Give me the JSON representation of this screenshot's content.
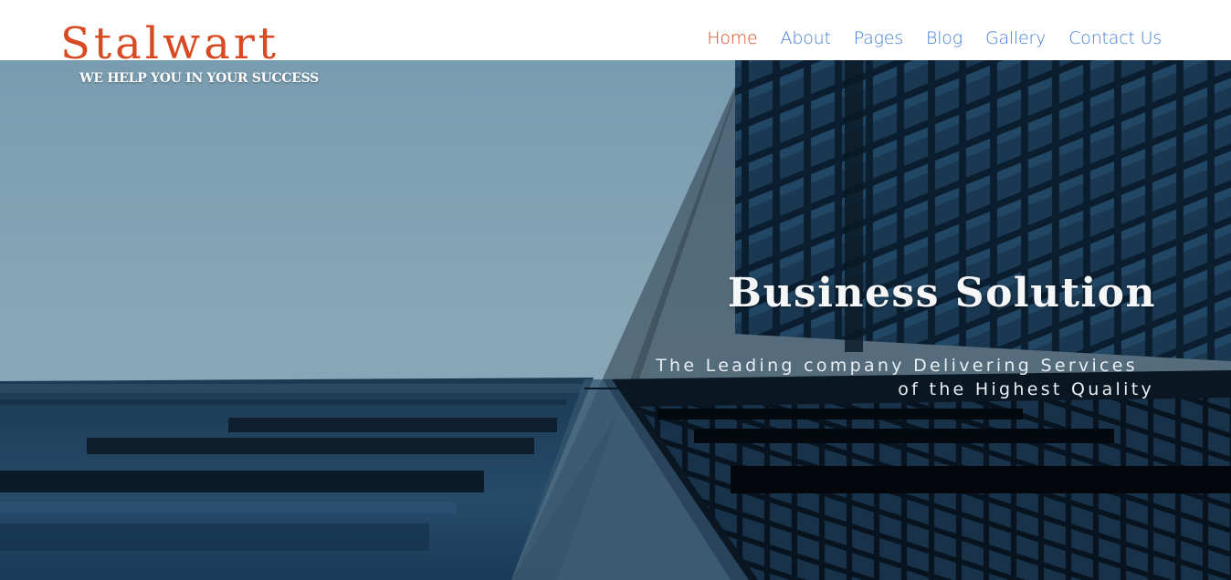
{
  "brand": {
    "name": "Stalwart",
    "tagline": "WE HELP YOU IN YOUR SUCCESS"
  },
  "nav": {
    "items": [
      {
        "label": "Home",
        "active": true
      },
      {
        "label": "About",
        "active": false
      },
      {
        "label": "Pages",
        "active": false
      },
      {
        "label": "Blog",
        "active": false
      },
      {
        "label": "Gallery",
        "active": false
      },
      {
        "label": "Contact Us",
        "active": false
      }
    ]
  },
  "hero": {
    "title": "Business Solution",
    "subtitle_line1": "The Leading company Delivering Services",
    "subtitle_line2": "of the Highest Quality",
    "image": "skyscraper-glass-facade"
  },
  "colors": {
    "brand_accent": "#d84a22",
    "nav_link": "#3f7fd6",
    "sky": "#7f9fb1",
    "building_dark": "#0f2436"
  }
}
